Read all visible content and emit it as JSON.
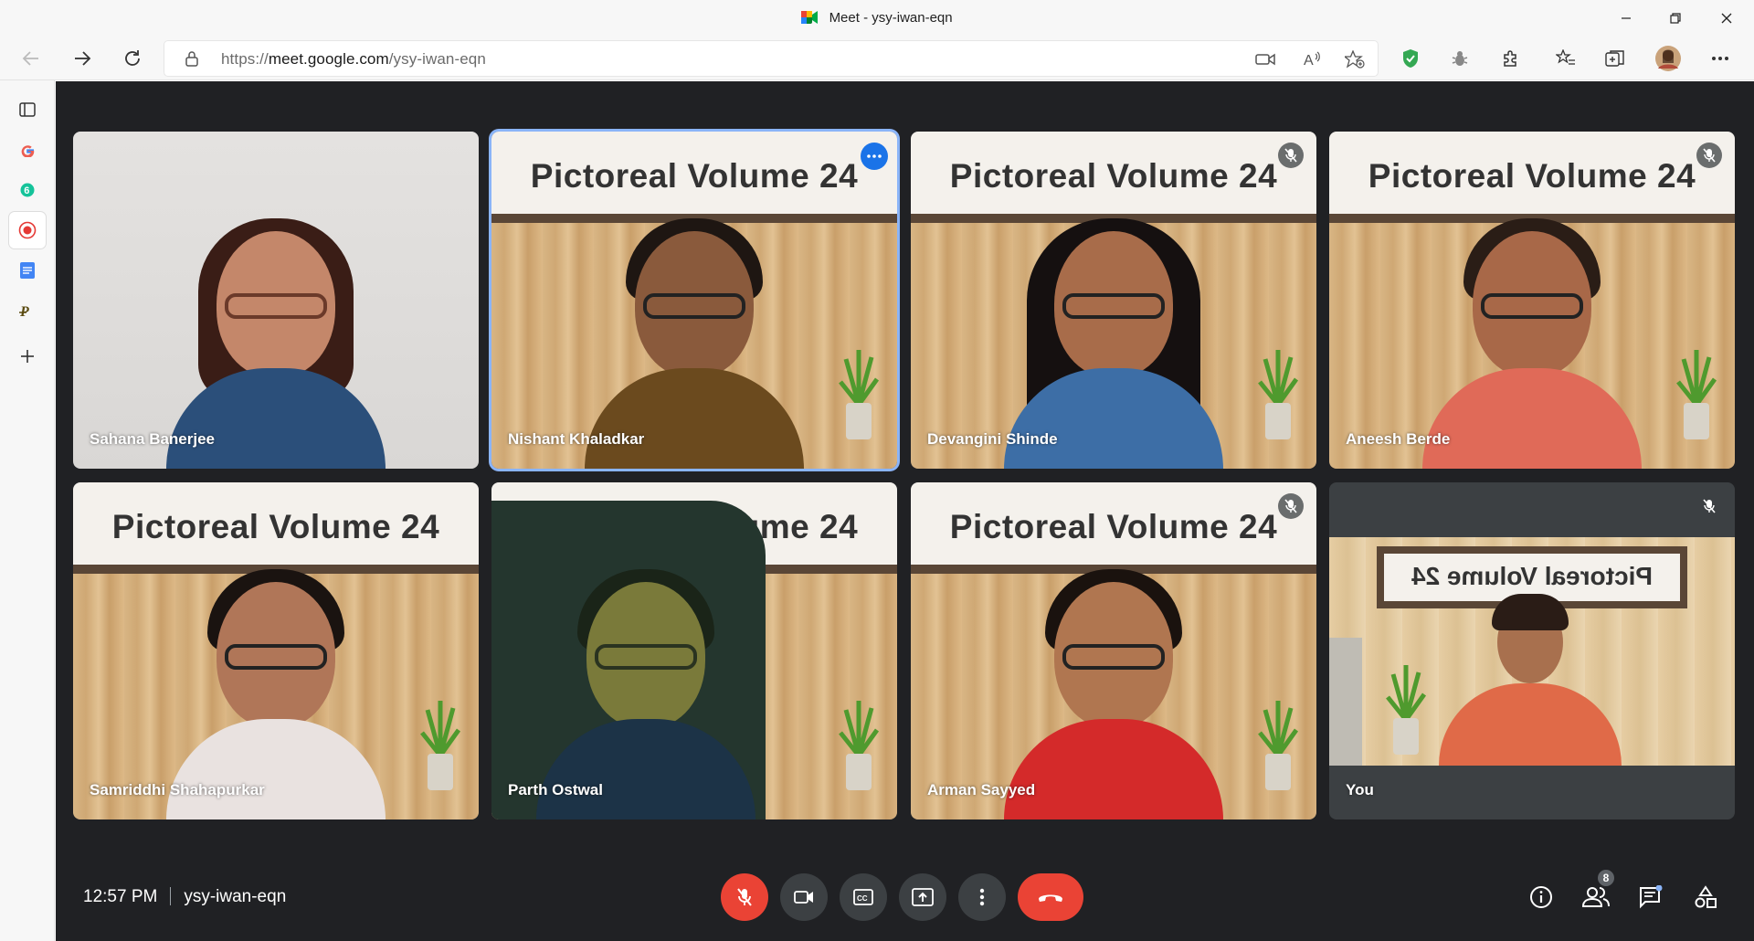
{
  "window": {
    "title": "Meet - ysy-iwan-eqn"
  },
  "browser": {
    "url_prefix": "https://",
    "url_host": "meet.google.com",
    "url_path": "/ysy-iwan-eqn"
  },
  "sidebar": {
    "items": [
      {
        "icon": "tab-actions-icon"
      },
      {
        "icon": "google-icon"
      },
      {
        "icon": "grammarly-icon"
      },
      {
        "icon": "screen-recorder-icon"
      },
      {
        "icon": "docs-icon"
      },
      {
        "icon": "pocket-icon"
      },
      {
        "icon": "add-icon"
      }
    ]
  },
  "meeting": {
    "time": "12:57 PM",
    "code": "ysy-iwan-eqn",
    "participant_count": "8",
    "banner_text": "Pictoreal Volume 24",
    "participants": [
      {
        "name": "Sahana Banerjee"
      },
      {
        "name": "Nishant Khaladkar"
      },
      {
        "name": "Devangini Shinde"
      },
      {
        "name": "Aneesh Berde"
      },
      {
        "name": "Samriddhi Shahapurkar"
      },
      {
        "name": "Parth Ostwal"
      },
      {
        "name": "Arman Sayyed"
      },
      {
        "name": "You"
      }
    ]
  },
  "colors": {
    "meet_bg": "#202124",
    "control_bg": "#3c4043",
    "danger": "#ea4335",
    "active_border": "#8ab4f8",
    "accent": "#1a73e8"
  }
}
